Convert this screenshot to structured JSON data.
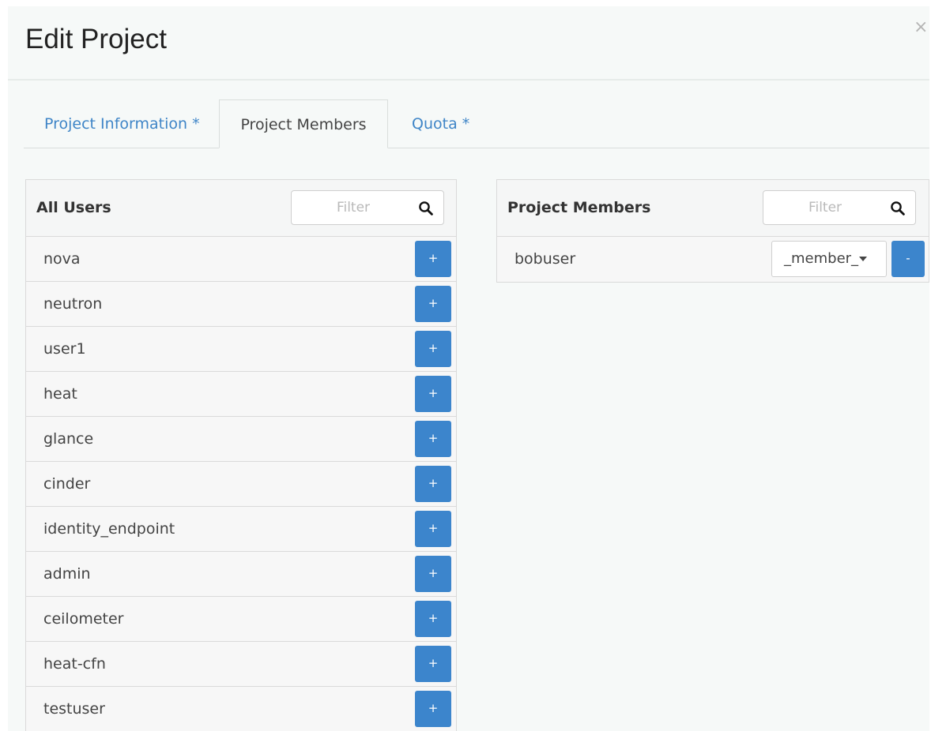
{
  "dialog": {
    "title": "Edit Project",
    "close_label": "×"
  },
  "tabs": [
    {
      "label": "Project Information *",
      "active": false
    },
    {
      "label": "Project Members",
      "active": true
    },
    {
      "label": "Quota *",
      "active": false
    }
  ],
  "all_users": {
    "title": "All Users",
    "filter_placeholder": "Filter",
    "add_label": "+",
    "users": [
      "nova",
      "neutron",
      "user1",
      "heat",
      "glance",
      "cinder",
      "identity_endpoint",
      "admin",
      "ceilometer",
      "heat-cfn",
      "testuser"
    ]
  },
  "project_members": {
    "title": "Project Members",
    "filter_placeholder": "Filter",
    "remove_label": "-",
    "members": [
      {
        "name": "bobuser",
        "role": "_member_"
      }
    ]
  },
  "icons": {
    "filter_search": "search-icon",
    "role_dropdown": "caret-down-icon"
  },
  "colors": {
    "link": "#3f85c7",
    "button": "#3c85cc"
  }
}
